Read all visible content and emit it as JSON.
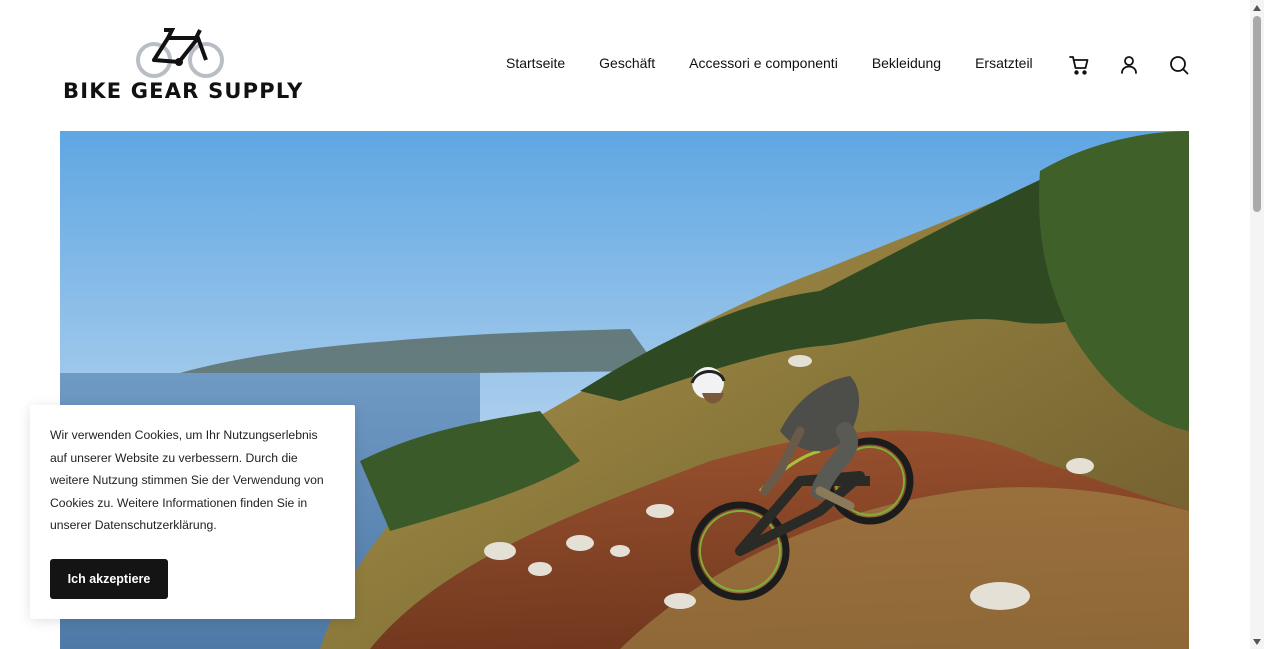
{
  "brand": {
    "name": "BIKE GEAR SUPPLY"
  },
  "nav": {
    "items": [
      {
        "label": "Startseite"
      },
      {
        "label": "Geschäft"
      },
      {
        "label": "Accessori e componenti"
      },
      {
        "label": "Bekleidung"
      },
      {
        "label": "Ersatzteil"
      }
    ]
  },
  "header_icons": [
    "cart-icon",
    "account-icon",
    "search-icon"
  ],
  "hero": {
    "image": "mountain-biker-on-coastal-trail"
  },
  "cookie_banner": {
    "text": "Wir verwenden Cookies, um Ihr Nutzungserlebnis auf unserer Website zu verbessern. Durch die weitere Nutzung stimmen Sie der Verwendung von Cookies zu. Weitere Informationen finden Sie in unserer Datenschutzerklärung.",
    "accept_label": "Ich akzeptiere"
  },
  "colors": {
    "button_bg": "#141414",
    "text": "#111111",
    "sky": "#8fbde6"
  }
}
